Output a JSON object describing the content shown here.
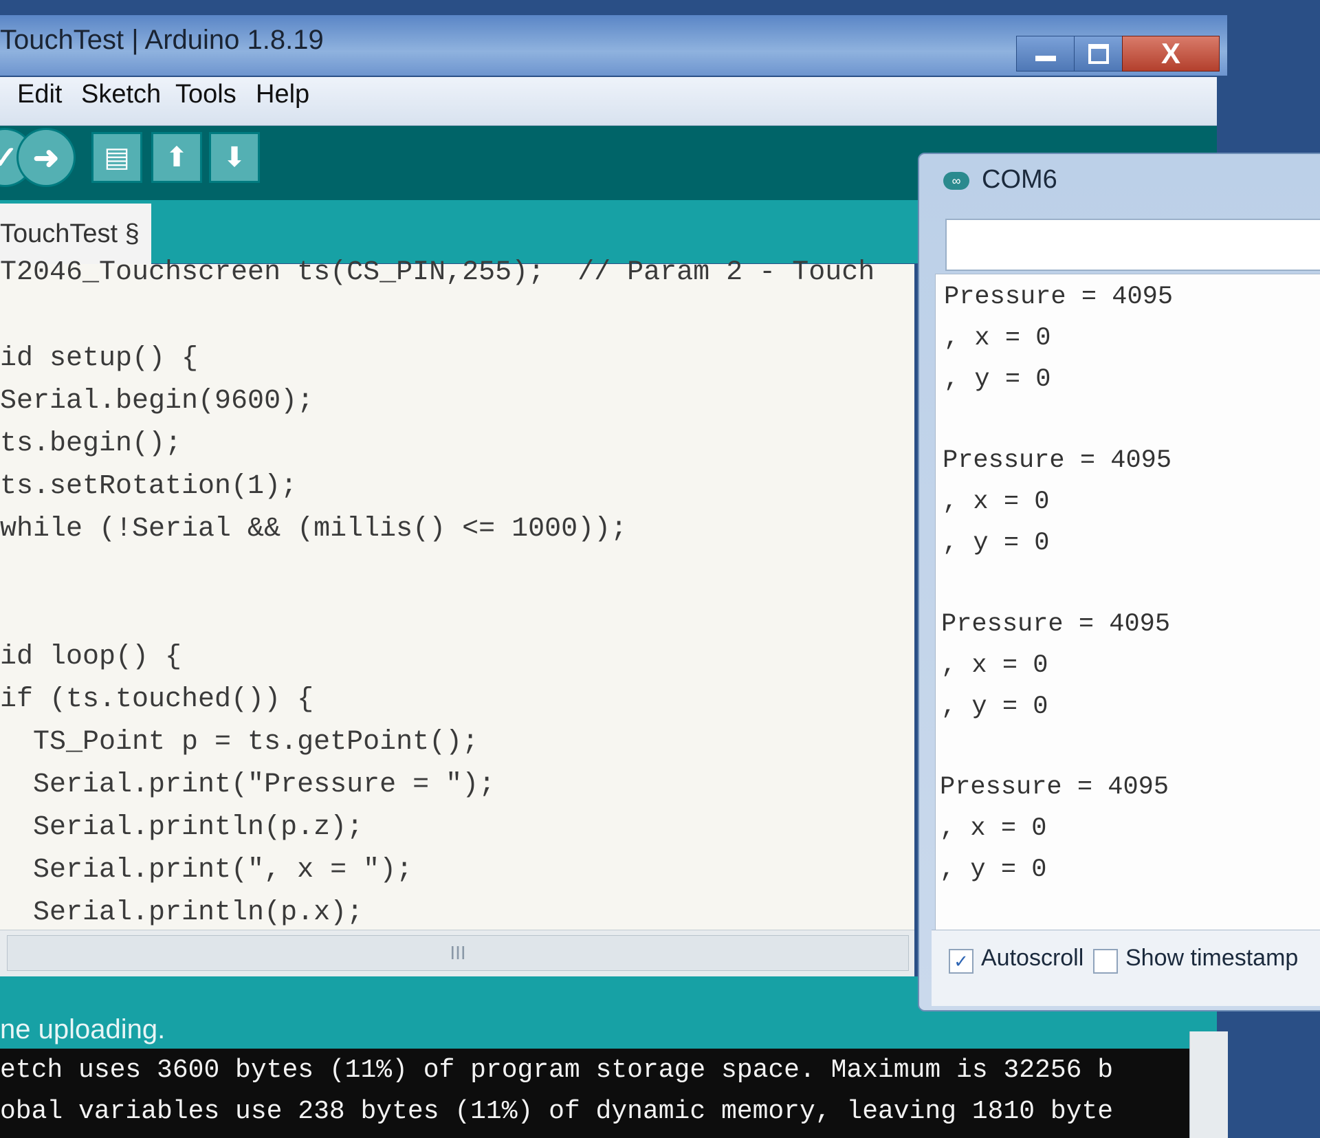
{
  "window": {
    "title": "TouchTest | Arduino 1.8.19",
    "close_label": "X"
  },
  "menu": [
    "Edit",
    "Sketch",
    "Tools",
    "Help"
  ],
  "toolbar": {
    "buttons": [
      "verify",
      "upload",
      "new",
      "open",
      "save"
    ]
  },
  "tab": {
    "label": "TouchTest §"
  },
  "editor": {
    "lines": [
      "T2046_Touchscreen ts(CS_PIN,255);  // Param 2 - Touch",
      "",
      "id setup() {",
      "Serial.begin(9600);",
      "ts.begin();",
      "ts.setRotation(1);",
      "while (!Serial && (millis() <= 1000));",
      "",
      "",
      "id loop() {",
      "if (ts.touched()) {",
      "  TS_Point p = ts.getPoint();",
      "  Serial.print(\"Pressure = \");",
      "  Serial.println(p.z);",
      "  Serial.print(\", x = \");",
      "  Serial.println(p.x);"
    ],
    "scroll_label": "III"
  },
  "status": {
    "text": "ne uploading."
  },
  "console": {
    "lines": [
      "etch uses 3600 bytes (11%) of program storage space. Maximum is 32256 b",
      "obal variables use 238 bytes (11%) of dynamic memory, leaving 1810 byte"
    ]
  },
  "serial_monitor": {
    "title": "COM6",
    "input_value": "",
    "output": [
      "Pressure = 4095",
      ", x = 0",
      ", y = 0",
      "",
      "Pressure = 4095",
      ", x = 0",
      ", y = 0",
      "",
      "Pressure = 4095",
      ", x = 0",
      ", y = 0",
      "",
      "Pressure = 4095",
      ", x = 0",
      ", y = 0"
    ],
    "autoscroll_label": "Autoscroll",
    "autoscroll_checked": true,
    "timestamp_label": "Show timestamp",
    "timestamp_checked": false
  }
}
